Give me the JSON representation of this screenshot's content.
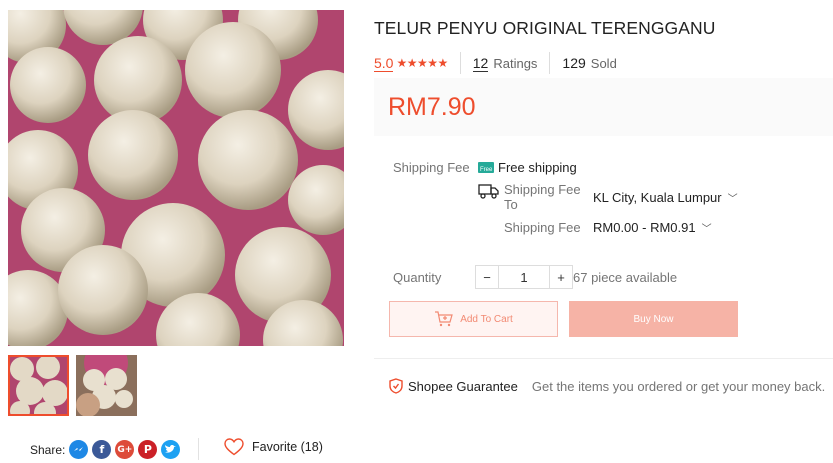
{
  "product": {
    "title": "TELUR PENYU ORIGINAL TERENGGANU",
    "rating": "5.0",
    "stars": "★★★★★",
    "ratings_count": "12",
    "ratings_label": "Ratings",
    "sold_count": "129",
    "sold_label": "Sold",
    "price": "RM7.90"
  },
  "shipping": {
    "label": "Shipping Fee",
    "free_text": "Free shipping",
    "to_label": "Shipping Fee\nTo",
    "to_line1": "Shipping Fee",
    "to_line2": "To",
    "location": "KL City, Kuala Lumpur",
    "fee_label": "Shipping Fee",
    "fee_range": "RM0.00 - RM0.91"
  },
  "quantity": {
    "label": "Quantity",
    "minus": "−",
    "value": "1",
    "plus": "+",
    "available": "67 piece available"
  },
  "actions": {
    "add_to_cart": "Add To Cart",
    "buy_now": "Buy Now"
  },
  "guarantee": {
    "title": "Shopee Guarantee",
    "desc": "Get the items you ordered or get your money back."
  },
  "share": {
    "label": "Share:",
    "icons": [
      "messenger-icon",
      "facebook-icon",
      "google-plus-icon",
      "pinterest-icon",
      "twitter-icon"
    ]
  },
  "favorite": {
    "label": "Favorite (18)"
  },
  "colors": {
    "brand": "#ee4d2d",
    "free_ship": "#26aa99",
    "messenger": "#1e88e5",
    "facebook": "#3b5998",
    "google_plus": "#dd4b39",
    "pinterest": "#cb2027",
    "twitter": "#1da1f2"
  }
}
